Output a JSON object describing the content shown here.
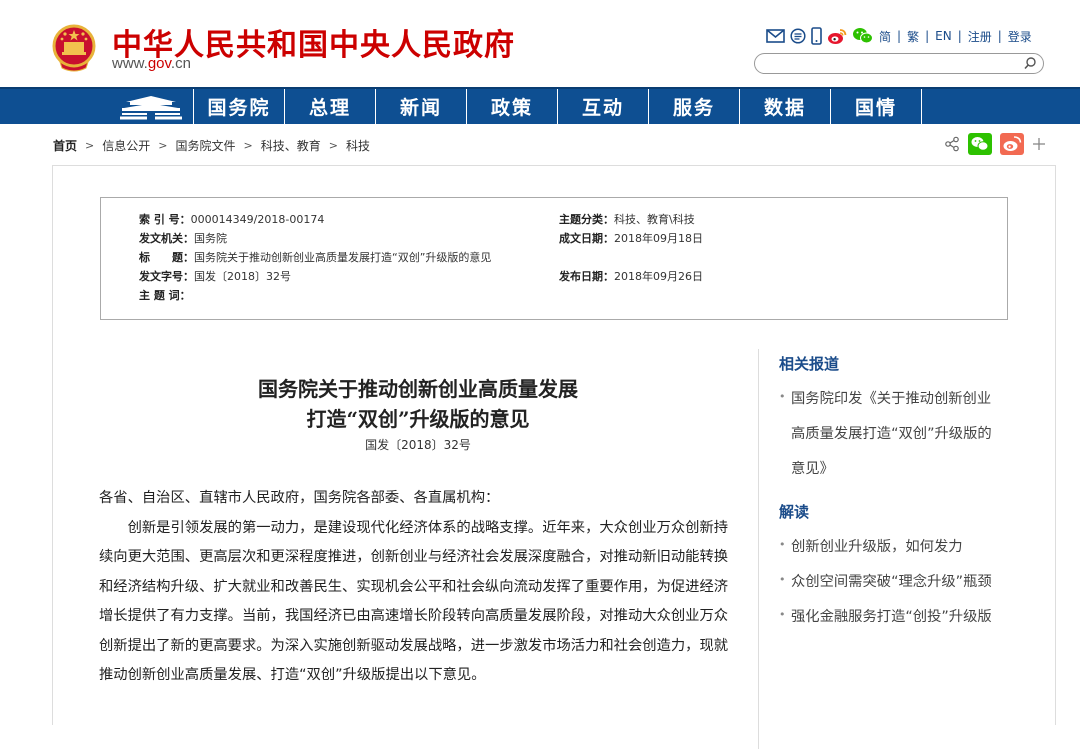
{
  "header": {
    "site_title": "中华人民共和国中央人民政府",
    "url_prefix": "www.",
    "url_mid": "gov",
    "url_suffix": ".cn",
    "tools": {
      "simplified": "简",
      "traditional": "繁",
      "english": "EN",
      "register": "注册",
      "login": "登录"
    },
    "search_placeholder": ""
  },
  "nav": {
    "items": [
      {
        "label": "国务院"
      },
      {
        "label": "总理"
      },
      {
        "label": "新闻"
      },
      {
        "label": "政策"
      },
      {
        "label": "互动"
      },
      {
        "label": "服务"
      },
      {
        "label": "数据"
      },
      {
        "label": "国情"
      }
    ]
  },
  "breadcrumb": {
    "items": [
      "首页",
      "信息公开",
      "国务院文件",
      "科技、教育",
      "科技"
    ],
    "sep": ">"
  },
  "meta": {
    "index_no_label": "索 引 号：",
    "index_no": "000014349/2018-00174",
    "topic_label": "主题分类：",
    "topic": "科技、教育\\科技",
    "issuer_label": "发文机关：",
    "issuer": "国务院",
    "date_label": "成文日期：",
    "date": "2018年09月18日",
    "title_label": "标　　题：",
    "title": "国务院关于推动创新创业高质量发展打造“双创”升级版的意见",
    "doc_no_label": "发文字号：",
    "doc_no": "国发〔2018〕32号",
    "pub_date_label": "发布日期：",
    "pub_date": "2018年09月26日",
    "keywords_label": "主 题 词："
  },
  "article": {
    "title_line1": "国务院关于推动创新创业高质量发展",
    "title_line2": "打造“双创”升级版的意见",
    "doc_no": "国发〔2018〕32号",
    "salutation": "各省、自治区、直辖市人民政府，国务院各部委、各直属机构：",
    "para1": "创新是引领发展的第一动力，是建设现代化经济体系的战略支撑。近年来，大众创业万众创新持续向更大范围、更高层次和更深程度推进，创新创业与经济社会发展深度融合，对推动新旧动能转换和经济结构升级、扩大就业和改善民生、实现机会公平和社会纵向流动发挥了重要作用，为促进经济增长提供了有力支撑。当前，我国经济已由高速增长阶段转向高质量发展阶段，对推动大众创业万众创新提出了新的更高要求。为深入实施创新驱动发展战略，进一步激发市场活力和社会创造力，现就推动创新创业高质量发展、打造“双创”升级版提出以下意见。"
  },
  "sidebar": {
    "related_heading": "相关报道",
    "related": [
      "国务院印发《关于推动创新创业高质量发展打造“双创”升级版的意见》"
    ],
    "interpret_heading": "解读",
    "interpret": [
      "创新创业升级版，如何发力",
      "众创空间需突破“理念升级”瓶颈",
      "强化金融服务打造“创投”升级版"
    ]
  },
  "colors": {
    "brand_red": "#cc0000",
    "nav_blue": "#0e4f92",
    "link_blue": "#1b4c8a"
  }
}
